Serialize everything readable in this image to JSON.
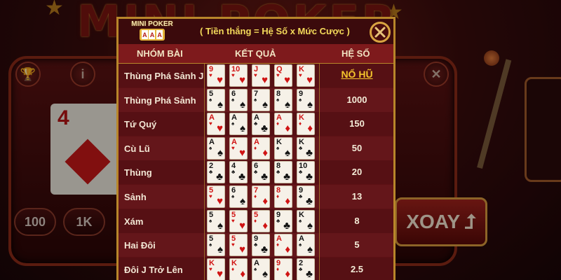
{
  "background": {
    "game_title": "MINI POKER",
    "bg_card_rank": "4",
    "bet_options": [
      "100",
      "1K"
    ],
    "spin_label": "XOAY",
    "icons": [
      "trophy-icon",
      "info-icon",
      "close-icon"
    ]
  },
  "popup": {
    "logo_text": "MINI POKER",
    "logo_cards": [
      "A",
      "A",
      "A"
    ],
    "formula": "( Tiền thắng = Hệ Số x Mức Cược )",
    "close_icon": "close-circle-icon",
    "headers": {
      "group": "NHÓM BÀI",
      "result": "KẾT QUẢ",
      "multiplier": "HỆ SỐ"
    },
    "rows": [
      {
        "name": "Thùng Phá Sảnh J",
        "payout": "NỔ HŨ",
        "cards": [
          [
            "9",
            "♥",
            "red"
          ],
          [
            "10",
            "♥",
            "red"
          ],
          [
            "J",
            "♥",
            "red"
          ],
          [
            "Q",
            "♥",
            "red"
          ],
          [
            "K",
            "♥",
            "red"
          ]
        ]
      },
      {
        "name": "Thùng Phá Sảnh",
        "payout": "1000",
        "cards": [
          [
            "5",
            "♠",
            "black"
          ],
          [
            "6",
            "♠",
            "black"
          ],
          [
            "7",
            "♠",
            "black"
          ],
          [
            "8",
            "♠",
            "black"
          ],
          [
            "9",
            "♠",
            "black"
          ]
        ]
      },
      {
        "name": "Tứ Quý",
        "payout": "150",
        "cards": [
          [
            "A",
            "♥",
            "red"
          ],
          [
            "A",
            "♠",
            "black"
          ],
          [
            "A",
            "♣",
            "black"
          ],
          [
            "A",
            "♦",
            "red"
          ],
          [
            "K",
            "♦",
            "red"
          ]
        ]
      },
      {
        "name": "Cù Lũ",
        "payout": "50",
        "cards": [
          [
            "A",
            "♠",
            "black"
          ],
          [
            "A",
            "♥",
            "red"
          ],
          [
            "A",
            "♦",
            "red"
          ],
          [
            "K",
            "♠",
            "black"
          ],
          [
            "K",
            "♣",
            "black"
          ]
        ]
      },
      {
        "name": "Thùng",
        "payout": "20",
        "cards": [
          [
            "2",
            "♣",
            "black"
          ],
          [
            "4",
            "♣",
            "black"
          ],
          [
            "6",
            "♣",
            "black"
          ],
          [
            "8",
            "♣",
            "black"
          ],
          [
            "10",
            "♣",
            "black"
          ]
        ]
      },
      {
        "name": "Sảnh",
        "payout": "13",
        "cards": [
          [
            "5",
            "♥",
            "red"
          ],
          [
            "6",
            "♠",
            "black"
          ],
          [
            "7",
            "♦",
            "red"
          ],
          [
            "8",
            "♦",
            "red"
          ],
          [
            "9",
            "♣",
            "black"
          ]
        ]
      },
      {
        "name": "Xám",
        "payout": "8",
        "cards": [
          [
            "5",
            "♠",
            "black"
          ],
          [
            "5",
            "♥",
            "red"
          ],
          [
            "5",
            "♦",
            "red"
          ],
          [
            "9",
            "♣",
            "black"
          ],
          [
            "K",
            "♠",
            "black"
          ]
        ]
      },
      {
        "name": "Hai Đôi",
        "payout": "5",
        "cards": [
          [
            "5",
            "♠",
            "black"
          ],
          [
            "5",
            "♥",
            "red"
          ],
          [
            "9",
            "♣",
            "black"
          ],
          [
            "A",
            "♦",
            "red"
          ],
          [
            "A",
            "♠",
            "black"
          ]
        ]
      },
      {
        "name": "Đôi J Trở Lên",
        "payout": "2.5",
        "cards": [
          [
            "K",
            "♥",
            "red"
          ],
          [
            "K",
            "♦",
            "red"
          ],
          [
            "A",
            "♠",
            "black"
          ],
          [
            "9",
            "♦",
            "red"
          ],
          [
            "2",
            "♣",
            "black"
          ]
        ]
      }
    ]
  }
}
